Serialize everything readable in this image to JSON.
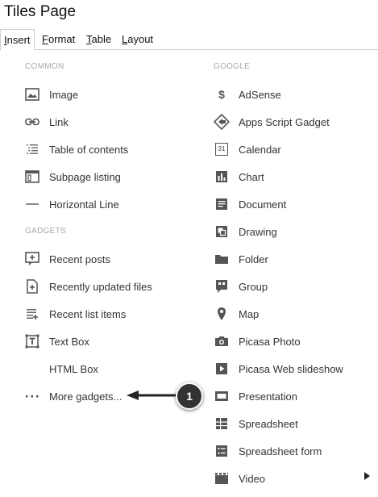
{
  "page_title": "Tiles Page",
  "tabs": [
    {
      "label": "Insert",
      "active": true
    },
    {
      "label": "Format",
      "active": false
    },
    {
      "label": "Table",
      "active": false
    },
    {
      "label": "Layout",
      "active": false
    }
  ],
  "common": {
    "heading": "COMMON",
    "items": [
      {
        "label": "Image",
        "icon": "image-icon"
      },
      {
        "label": "Link",
        "icon": "link-icon"
      },
      {
        "label": "Table of contents",
        "icon": "table-of-contents-icon"
      },
      {
        "label": "Subpage listing",
        "icon": "subpage-listing-icon"
      },
      {
        "label": "Horizontal Line",
        "icon": "horizontal-line-icon"
      }
    ]
  },
  "gadgets": {
    "heading": "GADGETS",
    "items": [
      {
        "label": "Recent posts",
        "icon": "recent-posts-icon"
      },
      {
        "label": "Recently updated files",
        "icon": "recently-updated-files-icon"
      },
      {
        "label": "Recent list items",
        "icon": "recent-list-items-icon"
      },
      {
        "label": "Text Box",
        "icon": "text-box-icon"
      },
      {
        "label": "HTML Box",
        "icon": ""
      },
      {
        "label": "More gadgets...",
        "icon": "more-dots-icon"
      }
    ]
  },
  "google": {
    "heading": "GOOGLE",
    "items": [
      {
        "label": "AdSense",
        "icon": "dollar-icon"
      },
      {
        "label": "Apps Script Gadget",
        "icon": "apps-script-icon"
      },
      {
        "label": "Calendar",
        "icon": "calendar-icon"
      },
      {
        "label": "Chart",
        "icon": "chart-icon"
      },
      {
        "label": "Document",
        "icon": "document-icon"
      },
      {
        "label": "Drawing",
        "icon": "drawing-icon"
      },
      {
        "label": "Folder",
        "icon": "folder-icon"
      },
      {
        "label": "Group",
        "icon": "group-icon"
      },
      {
        "label": "Map",
        "icon": "map-pin-icon"
      },
      {
        "label": "Picasa Photo",
        "icon": "camera-icon"
      },
      {
        "label": "Picasa Web slideshow",
        "icon": "slideshow-icon"
      },
      {
        "label": "Presentation",
        "icon": "presentation-icon"
      },
      {
        "label": "Spreadsheet",
        "icon": "spreadsheet-icon"
      },
      {
        "label": "Spreadsheet form",
        "icon": "spreadsheet-form-icon"
      },
      {
        "label": "Video",
        "icon": "video-icon"
      }
    ]
  },
  "callout": {
    "number": "1"
  },
  "calendar_icon_text": "31"
}
